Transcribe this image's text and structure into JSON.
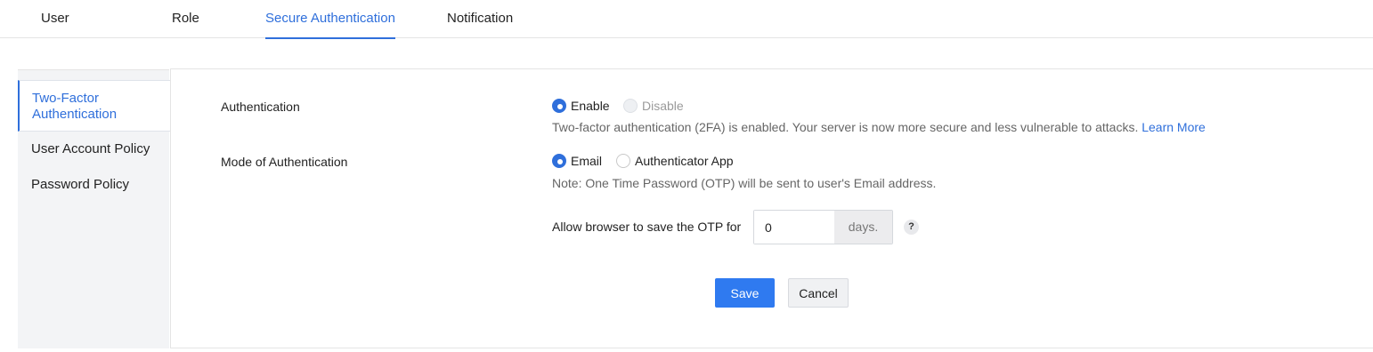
{
  "tabs": [
    {
      "label": "User"
    },
    {
      "label": "Role"
    },
    {
      "label": "Secure Authentication",
      "active": true
    },
    {
      "label": "Notification"
    }
  ],
  "sidebar": {
    "items": [
      {
        "label": "Two-Factor Authentication",
        "active": true
      },
      {
        "label": "User Account Policy"
      },
      {
        "label": "Password Policy"
      }
    ]
  },
  "form": {
    "authentication": {
      "label": "Authentication",
      "options": [
        "Enable",
        "Disable"
      ],
      "selected": "Enable",
      "description": "Two-factor authentication (2FA) is enabled. Your server is now more secure and less vulnerable to attacks.",
      "learn_more": "Learn More"
    },
    "mode": {
      "label": "Mode of Authentication",
      "options": [
        "Email",
        "Authenticator App"
      ],
      "selected": "Email",
      "note": "Note: One Time Password (OTP) will be sent to user's Email address."
    },
    "otp": {
      "label": "Allow browser to save the OTP for",
      "value": "0",
      "suffix": "days.",
      "help": "?"
    },
    "save_label": "Save",
    "cancel_label": "Cancel"
  },
  "colors": {
    "accent": "#2f6fdb",
    "save_button": "#2f7af0"
  }
}
